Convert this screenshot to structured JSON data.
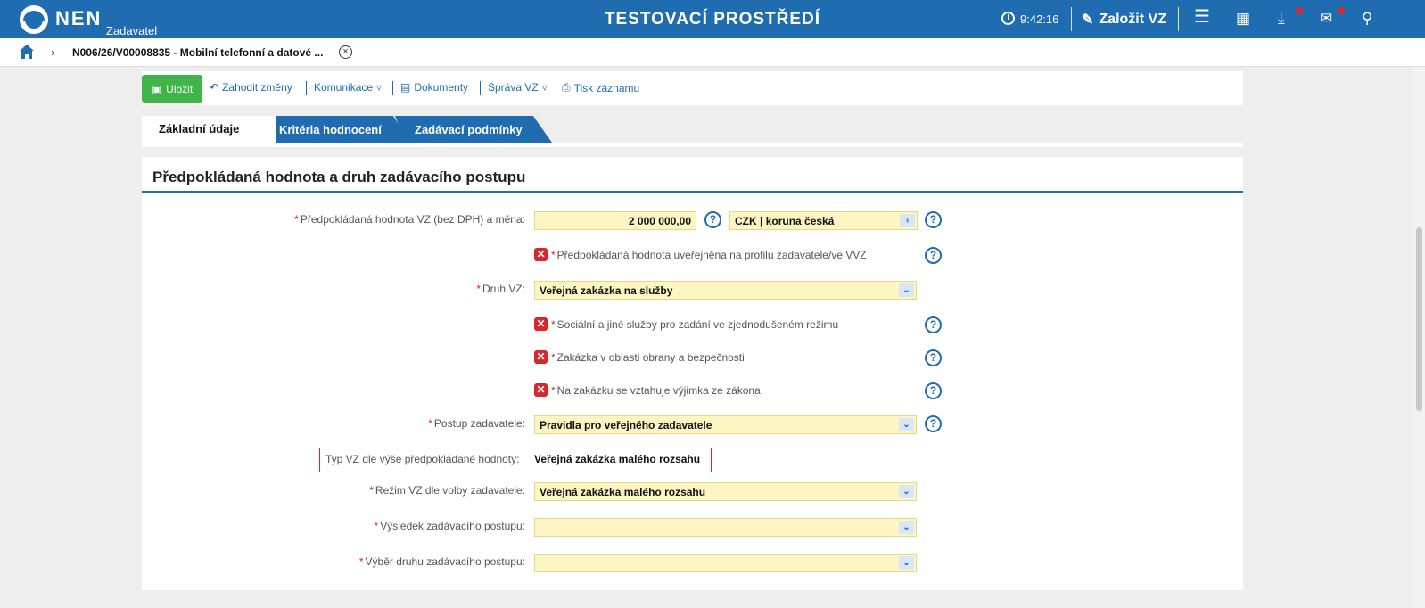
{
  "header": {
    "brand": "NEN",
    "brand_sub": "Zadavatel",
    "env_title": "TESTOVACÍ PROSTŘEDÍ",
    "time": "9:42:16",
    "new_vz": "Založit VZ",
    "badge_color": "#e4262b",
    "bar_color": "#1f6db0"
  },
  "breadcrumb": {
    "title": "N006/26/V00008835 - Mobilní telefonní a datové ..."
  },
  "toolbar": {
    "save": "Uložit",
    "discard": "Zahodit změny",
    "communication": "Komunikace",
    "documents": "Dokumenty",
    "manage": "Správa VZ",
    "print": "Tisk záznamu"
  },
  "tabs": [
    "Základní údaje",
    "Kritéria hodnocení",
    "Zadávací podmínky"
  ],
  "panel": {
    "title": "Předpokládaná hodnota a druh zadávacího postupu",
    "value_label": "Předpokládaná hodnota VZ (bez DPH) a měna:",
    "value": "2 000 000,00",
    "currency": "CZK | koruna česká",
    "published_label": "Předpokládaná hodnota uveřejněna na profilu zadavatele/ve VVZ",
    "type_label": "Druh VZ:",
    "type_value": "Veřejná zakázka na služby",
    "social_label": "Sociální a jiné služby pro zadání ve zjednodušeném režimu",
    "defense_label": "Zakázka v oblasti obrany a bezpečnosti",
    "exception_label": "Na zakázku se vztahuje výjimka ze zákona",
    "procedure_label": "Postup zadavatele:",
    "procedure_value": "Pravidla pro veřejného zadavatele",
    "size_label": "Typ VZ dle výše předpokládané hodnoty:",
    "size_value": "Veřejná zakázka malého rozsahu",
    "regime_label": "Režim VZ dle volby zadavatele:",
    "regime_value": "Veřejná zakázka malého rozsahu",
    "result_label": "Výsledek zadávacího postupu:",
    "result_value": "",
    "selection_label": "Výběr druhu zadávacího postupu:",
    "selection_value": ""
  }
}
